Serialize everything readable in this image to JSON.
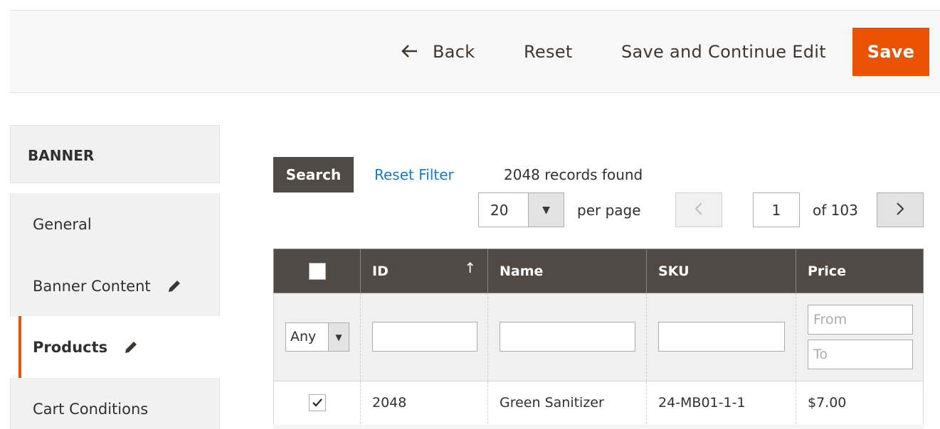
{
  "toolbar": {
    "back_label": "Back",
    "reset_label": "Reset",
    "save_continue_label": "Save and Continue Edit",
    "save_label": "Save",
    "save_color": "#eb5202"
  },
  "sidebar": {
    "heading": "BANNER",
    "items": [
      {
        "label": "General",
        "icon": null,
        "active": false
      },
      {
        "label": "Banner Content",
        "icon": "pencil-icon",
        "active": false
      },
      {
        "label": "Products",
        "icon": "pencil-icon",
        "active": true
      },
      {
        "label": "Cart Conditions",
        "icon": null,
        "active": false
      }
    ],
    "active_color": "#eb5202"
  },
  "grid": {
    "search_label": "Search",
    "reset_filter_label": "Reset Filter",
    "records_found": "2048 records found",
    "per_page_value": "20",
    "per_page_label": "per page",
    "current_page": "1",
    "page_total": "of 103",
    "columns": [
      "ID",
      "Name",
      "SKU",
      "Price"
    ],
    "sort_indicator": "↑",
    "filters": {
      "select_value": "Any",
      "price_from_placeholder": "From",
      "price_to_placeholder": "To"
    },
    "rows": [
      {
        "checked": true,
        "id": "2048",
        "name": "Green Sanitizer",
        "sku": "24-MB01-1-1",
        "price": "$7.00"
      }
    ],
    "header_color": "#514943",
    "link_color": "#1979c3"
  }
}
